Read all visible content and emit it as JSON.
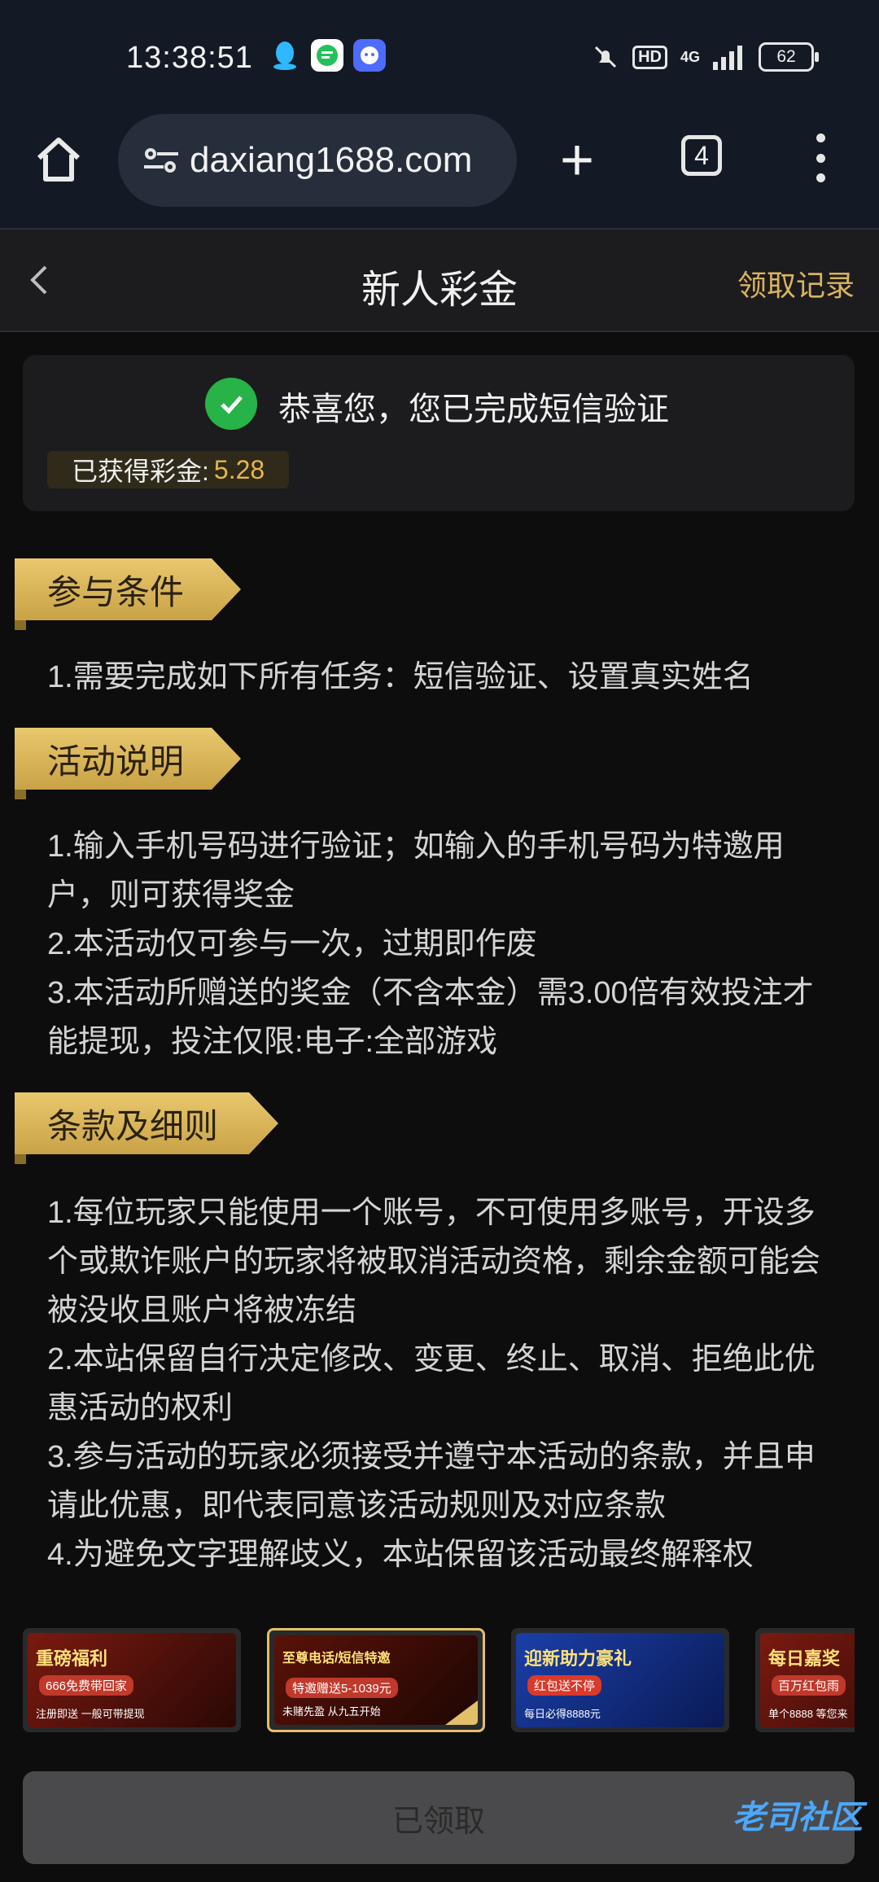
{
  "status_bar": {
    "time": "13:38:51",
    "hd_label": "HD",
    "network_label": "4G",
    "battery": "62"
  },
  "browser": {
    "url": "daxiang1688.com",
    "tab_count": "4"
  },
  "header": {
    "title": "新人彩金",
    "records_link": "领取记录"
  },
  "success_card": {
    "message": "恭喜您，您已完成短信验证",
    "bonus_label": "已获得彩金:",
    "bonus_value": "5.28"
  },
  "sections": [
    {
      "title": "参与条件",
      "lines": [
        "1.需要完成如下所有任务：短信验证、设置真实姓名"
      ]
    },
    {
      "title": "活动说明",
      "lines": [
        "1.输入手机号码进行验证；如输入的手机号码为特邀用户，则可获得奖金",
        "2.本活动仅可参与一次，过期即作废",
        "3.本活动所赠送的奖金（不含本金）需3.00倍有效投注才能提现，投注仅限:电子:全部游戏"
      ]
    },
    {
      "title": "条款及细则",
      "lines": [
        "1.每位玩家只能使用一个账号，不可使用多账号，开设多个或欺诈账户的玩家将被取消活动资格，剩余金额可能会被没收且账户将被冻结",
        "2.本站保留自行决定修改、变更、终止、取消、拒绝此优惠活动的权利",
        "3.参与活动的玩家必须接受并遵守本活动的条款，并且申请此优惠，即代表同意该活动规则及对应条款",
        "4.为避免文字理解歧义，本站保留该活动最终解释权"
      ]
    }
  ],
  "banners": [
    {
      "title": "重磅福利",
      "sub": "666免费带回家",
      "foot": "注册即送 一般可带提现",
      "bg": "#7a1a10",
      "sub_bg": "#c0392b"
    },
    {
      "title": "至尊电话/短信特邀",
      "sub": "特邀赠送5-1039元",
      "foot": "未赌先盈 从九五开始",
      "bg": "#5a1208",
      "sub_bg": "#c0392b"
    },
    {
      "title": "迎新助力豪礼",
      "sub": "红包送不停",
      "foot": "每日必得8888元",
      "bg": "#1b3fa8",
      "sub_bg": "#d93a2b"
    },
    {
      "title": "每日嘉奖",
      "sub": "百万红包雨",
      "foot": "单个8888 等您来",
      "bg": "#7a1a10",
      "sub_bg": "#c0392b"
    }
  ],
  "bottom": {
    "button_label": "已领取",
    "watermark": "老司社区"
  },
  "colors": {
    "accent_gold": "#d9b45e",
    "success_green": "#27b347",
    "bonus_value": "#e7b64b"
  }
}
